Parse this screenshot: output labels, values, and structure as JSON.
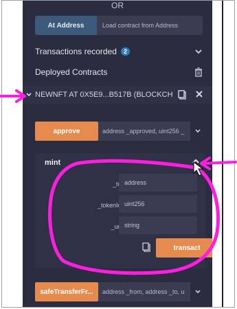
{
  "header": {
    "or_label": "OR"
  },
  "at_address": {
    "button_label": "At Address",
    "placeholder": "Load contract from Address"
  },
  "transactions": {
    "label": "Transactions recorded",
    "count": "2"
  },
  "deployed": {
    "label": "Deployed Contracts"
  },
  "contract": {
    "label": "NEWNFT AT 0X5E9...B517B (BLOCKCH"
  },
  "functions": {
    "approve": {
      "label": "approve",
      "params": "address _approved, uint256 _"
    },
    "mint": {
      "label": "mint",
      "params": [
        {
          "label": "_to:",
          "placeholder": "address"
        },
        {
          "label": "_tokenId:",
          "placeholder": "uint256"
        },
        {
          "label": "_uri:",
          "placeholder": "string"
        }
      ],
      "transact_label": "transact"
    },
    "safe_transfer": {
      "label": "safeTransferFr...",
      "params": "address _from, address _to, u"
    }
  },
  "colors": {
    "panel_bg": "#2a2c3f",
    "accent_orange": "#e48b4d",
    "button_blue": "#3d5a7c",
    "badge_blue": "#2f7cc2",
    "annotation_magenta": "#ff1ee0"
  }
}
